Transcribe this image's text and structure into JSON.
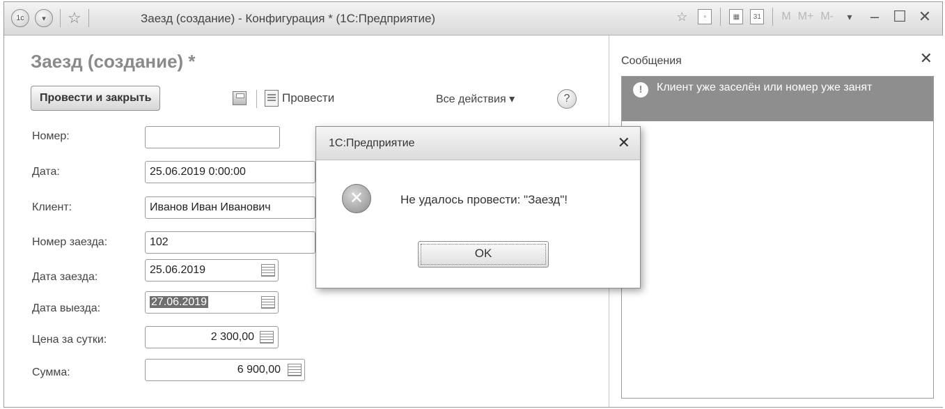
{
  "window": {
    "title": "Заезд (создание) - Конфигурация * (1С:Предприятие)",
    "app_icon": "1c-logo-icon",
    "memory_buttons": [
      "M",
      "M+",
      "M-"
    ]
  },
  "form": {
    "title": "Заезд (создание) *",
    "toolbar": {
      "post_close_label": "Провести и закрыть",
      "post_label": "Провести",
      "all_actions_label": "Все действия ▾",
      "help_label": "?"
    },
    "fields": {
      "number": {
        "label": "Номер:",
        "value": ""
      },
      "date": {
        "label": "Дата:",
        "value": "25.06.2019  0:00:00"
      },
      "client": {
        "label": "Клиент:",
        "value": "Иванов Иван Иванович"
      },
      "room": {
        "label": "Номер заезда:",
        "value": "102"
      },
      "checkin": {
        "label": "Дата заезда:",
        "value": "25.06.2019"
      },
      "checkout": {
        "label": "Дата выезда:",
        "value": "27.06.2019"
      },
      "price": {
        "label": "Цена за сутки:",
        "value": "2 300,00"
      },
      "sum": {
        "label": "Сумма:",
        "value": "6 900,00"
      }
    }
  },
  "messages": {
    "title": "Сообщения",
    "items": [
      {
        "text": "Клиент уже заселён или номер уже занят"
      }
    ]
  },
  "dialog": {
    "title": "1С:Предприятие",
    "message": "Не удалось провести: \"Заезд\"!",
    "ok_label": "OK"
  }
}
